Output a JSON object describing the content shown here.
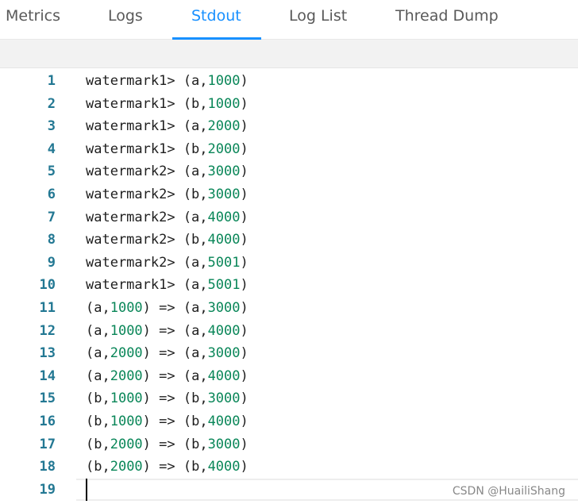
{
  "tabs": [
    {
      "label": "Metrics",
      "active": false
    },
    {
      "label": "Logs",
      "active": false
    },
    {
      "label": "Stdout",
      "active": true
    },
    {
      "label": "Log List",
      "active": false
    },
    {
      "label": "Thread Dump",
      "active": false
    }
  ],
  "editor": {
    "lines": [
      {
        "num": "1",
        "parts": [
          {
            "t": "watermark1> (a,"
          },
          {
            "t": "1000",
            "n": true
          },
          {
            "t": ")"
          }
        ]
      },
      {
        "num": "2",
        "parts": [
          {
            "t": "watermark1> (b,"
          },
          {
            "t": "1000",
            "n": true
          },
          {
            "t": ")"
          }
        ]
      },
      {
        "num": "3",
        "parts": [
          {
            "t": "watermark1> (a,"
          },
          {
            "t": "2000",
            "n": true
          },
          {
            "t": ")"
          }
        ]
      },
      {
        "num": "4",
        "parts": [
          {
            "t": "watermark1> (b,"
          },
          {
            "t": "2000",
            "n": true
          },
          {
            "t": ")"
          }
        ]
      },
      {
        "num": "5",
        "parts": [
          {
            "t": "watermark2> (a,"
          },
          {
            "t": "3000",
            "n": true
          },
          {
            "t": ")"
          }
        ]
      },
      {
        "num": "6",
        "parts": [
          {
            "t": "watermark2> (b,"
          },
          {
            "t": "3000",
            "n": true
          },
          {
            "t": ")"
          }
        ]
      },
      {
        "num": "7",
        "parts": [
          {
            "t": "watermark2> (a,"
          },
          {
            "t": "4000",
            "n": true
          },
          {
            "t": ")"
          }
        ]
      },
      {
        "num": "8",
        "parts": [
          {
            "t": "watermark2> (b,"
          },
          {
            "t": "4000",
            "n": true
          },
          {
            "t": ")"
          }
        ]
      },
      {
        "num": "9",
        "parts": [
          {
            "t": "watermark2> (a,"
          },
          {
            "t": "5001",
            "n": true
          },
          {
            "t": ")"
          }
        ]
      },
      {
        "num": "10",
        "parts": [
          {
            "t": "watermark1> (a,"
          },
          {
            "t": "5001",
            "n": true
          },
          {
            "t": ")"
          }
        ]
      },
      {
        "num": "11",
        "parts": [
          {
            "t": "(a,"
          },
          {
            "t": "1000",
            "n": true
          },
          {
            "t": ") => (a,"
          },
          {
            "t": "3000",
            "n": true
          },
          {
            "t": ")"
          }
        ]
      },
      {
        "num": "12",
        "parts": [
          {
            "t": "(a,"
          },
          {
            "t": "1000",
            "n": true
          },
          {
            "t": ") => (a,"
          },
          {
            "t": "4000",
            "n": true
          },
          {
            "t": ")"
          }
        ]
      },
      {
        "num": "13",
        "parts": [
          {
            "t": "(a,"
          },
          {
            "t": "2000",
            "n": true
          },
          {
            "t": ") => (a,"
          },
          {
            "t": "3000",
            "n": true
          },
          {
            "t": ")"
          }
        ]
      },
      {
        "num": "14",
        "parts": [
          {
            "t": "(a,"
          },
          {
            "t": "2000",
            "n": true
          },
          {
            "t": ") => (a,"
          },
          {
            "t": "4000",
            "n": true
          },
          {
            "t": ")"
          }
        ]
      },
      {
        "num": "15",
        "parts": [
          {
            "t": "(b,"
          },
          {
            "t": "1000",
            "n": true
          },
          {
            "t": ") => (b,"
          },
          {
            "t": "3000",
            "n": true
          },
          {
            "t": ")"
          }
        ]
      },
      {
        "num": "16",
        "parts": [
          {
            "t": "(b,"
          },
          {
            "t": "1000",
            "n": true
          },
          {
            "t": ") => (b,"
          },
          {
            "t": "4000",
            "n": true
          },
          {
            "t": ")"
          }
        ]
      },
      {
        "num": "17",
        "parts": [
          {
            "t": "(b,"
          },
          {
            "t": "2000",
            "n": true
          },
          {
            "t": ") => (b,"
          },
          {
            "t": "3000",
            "n": true
          },
          {
            "t": ")"
          }
        ]
      },
      {
        "num": "18",
        "parts": [
          {
            "t": "(b,"
          },
          {
            "t": "2000",
            "n": true
          },
          {
            "t": ") => (b,"
          },
          {
            "t": "4000",
            "n": true
          },
          {
            "t": ")"
          }
        ]
      },
      {
        "num": "19",
        "parts": []
      }
    ]
  },
  "watermark": "CSDN @HuailiShang",
  "colors": {
    "accent": "#1890ff",
    "line_number": "#237893",
    "number_literal": "#098658"
  }
}
